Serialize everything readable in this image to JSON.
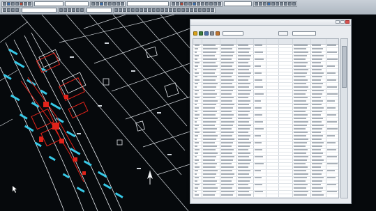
{
  "toolbar": {
    "combos": [
      "",
      "",
      "",
      ""
    ]
  },
  "table_window": {
    "title": "",
    "menus": [
      "",
      "",
      "",
      ""
    ],
    "combo_value": "",
    "button_label": "",
    "search_placeholder": "",
    "status": ""
  },
  "colors": {
    "cad_background": "#06090c",
    "cad_lines": "#d6dbe0",
    "cad_cyan": "#37c8e6",
    "cad_red": "#e2231a",
    "window_background": "#e9ecf0"
  },
  "icons": [
    "pencil-icon",
    "tool-icon",
    "minimize-icon",
    "maximize-icon",
    "close-icon"
  ]
}
